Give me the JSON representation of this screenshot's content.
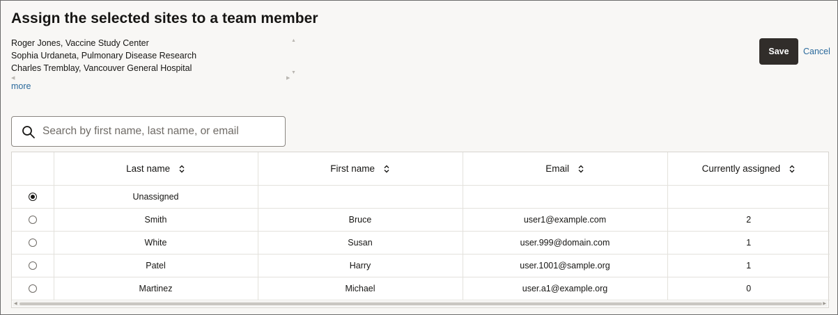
{
  "page": {
    "title": "Assign the selected sites to a team member"
  },
  "sites": {
    "items": [
      "Roger Jones, Vaccine Study Center",
      "Sophia Urdaneta, Pulmonary Disease Research",
      "Charles Tremblay, Vancouver General Hospital"
    ],
    "more_label": "more"
  },
  "actions": {
    "save_label": "Save",
    "cancel_label": "Cancel"
  },
  "search": {
    "placeholder": "Search by first name, last name, or email",
    "value": "",
    "icon": "search-icon"
  },
  "table": {
    "columns": [
      "Last name",
      "First name",
      "Email",
      "Currently assigned"
    ],
    "sortable_icon": "sort-icon",
    "rows": [
      {
        "selected": true,
        "last_name": "Unassigned",
        "first_name": "",
        "email": "",
        "assigned": ""
      },
      {
        "selected": false,
        "last_name": "Smith",
        "first_name": "Bruce",
        "email": "user1@example.com",
        "assigned": "2"
      },
      {
        "selected": false,
        "last_name": "White",
        "first_name": "Susan",
        "email": "user.999@domain.com",
        "assigned": "1"
      },
      {
        "selected": false,
        "last_name": "Patel",
        "first_name": "Harry",
        "email": "user.1001@sample.org",
        "assigned": "1"
      },
      {
        "selected": false,
        "last_name": "Martinez",
        "first_name": "Michael",
        "email": "user.a1@example.org",
        "assigned": "0"
      }
    ]
  },
  "colors": {
    "primary_button": "#312d2a",
    "link": "#2b6a9c",
    "background": "#f8f7f5"
  }
}
